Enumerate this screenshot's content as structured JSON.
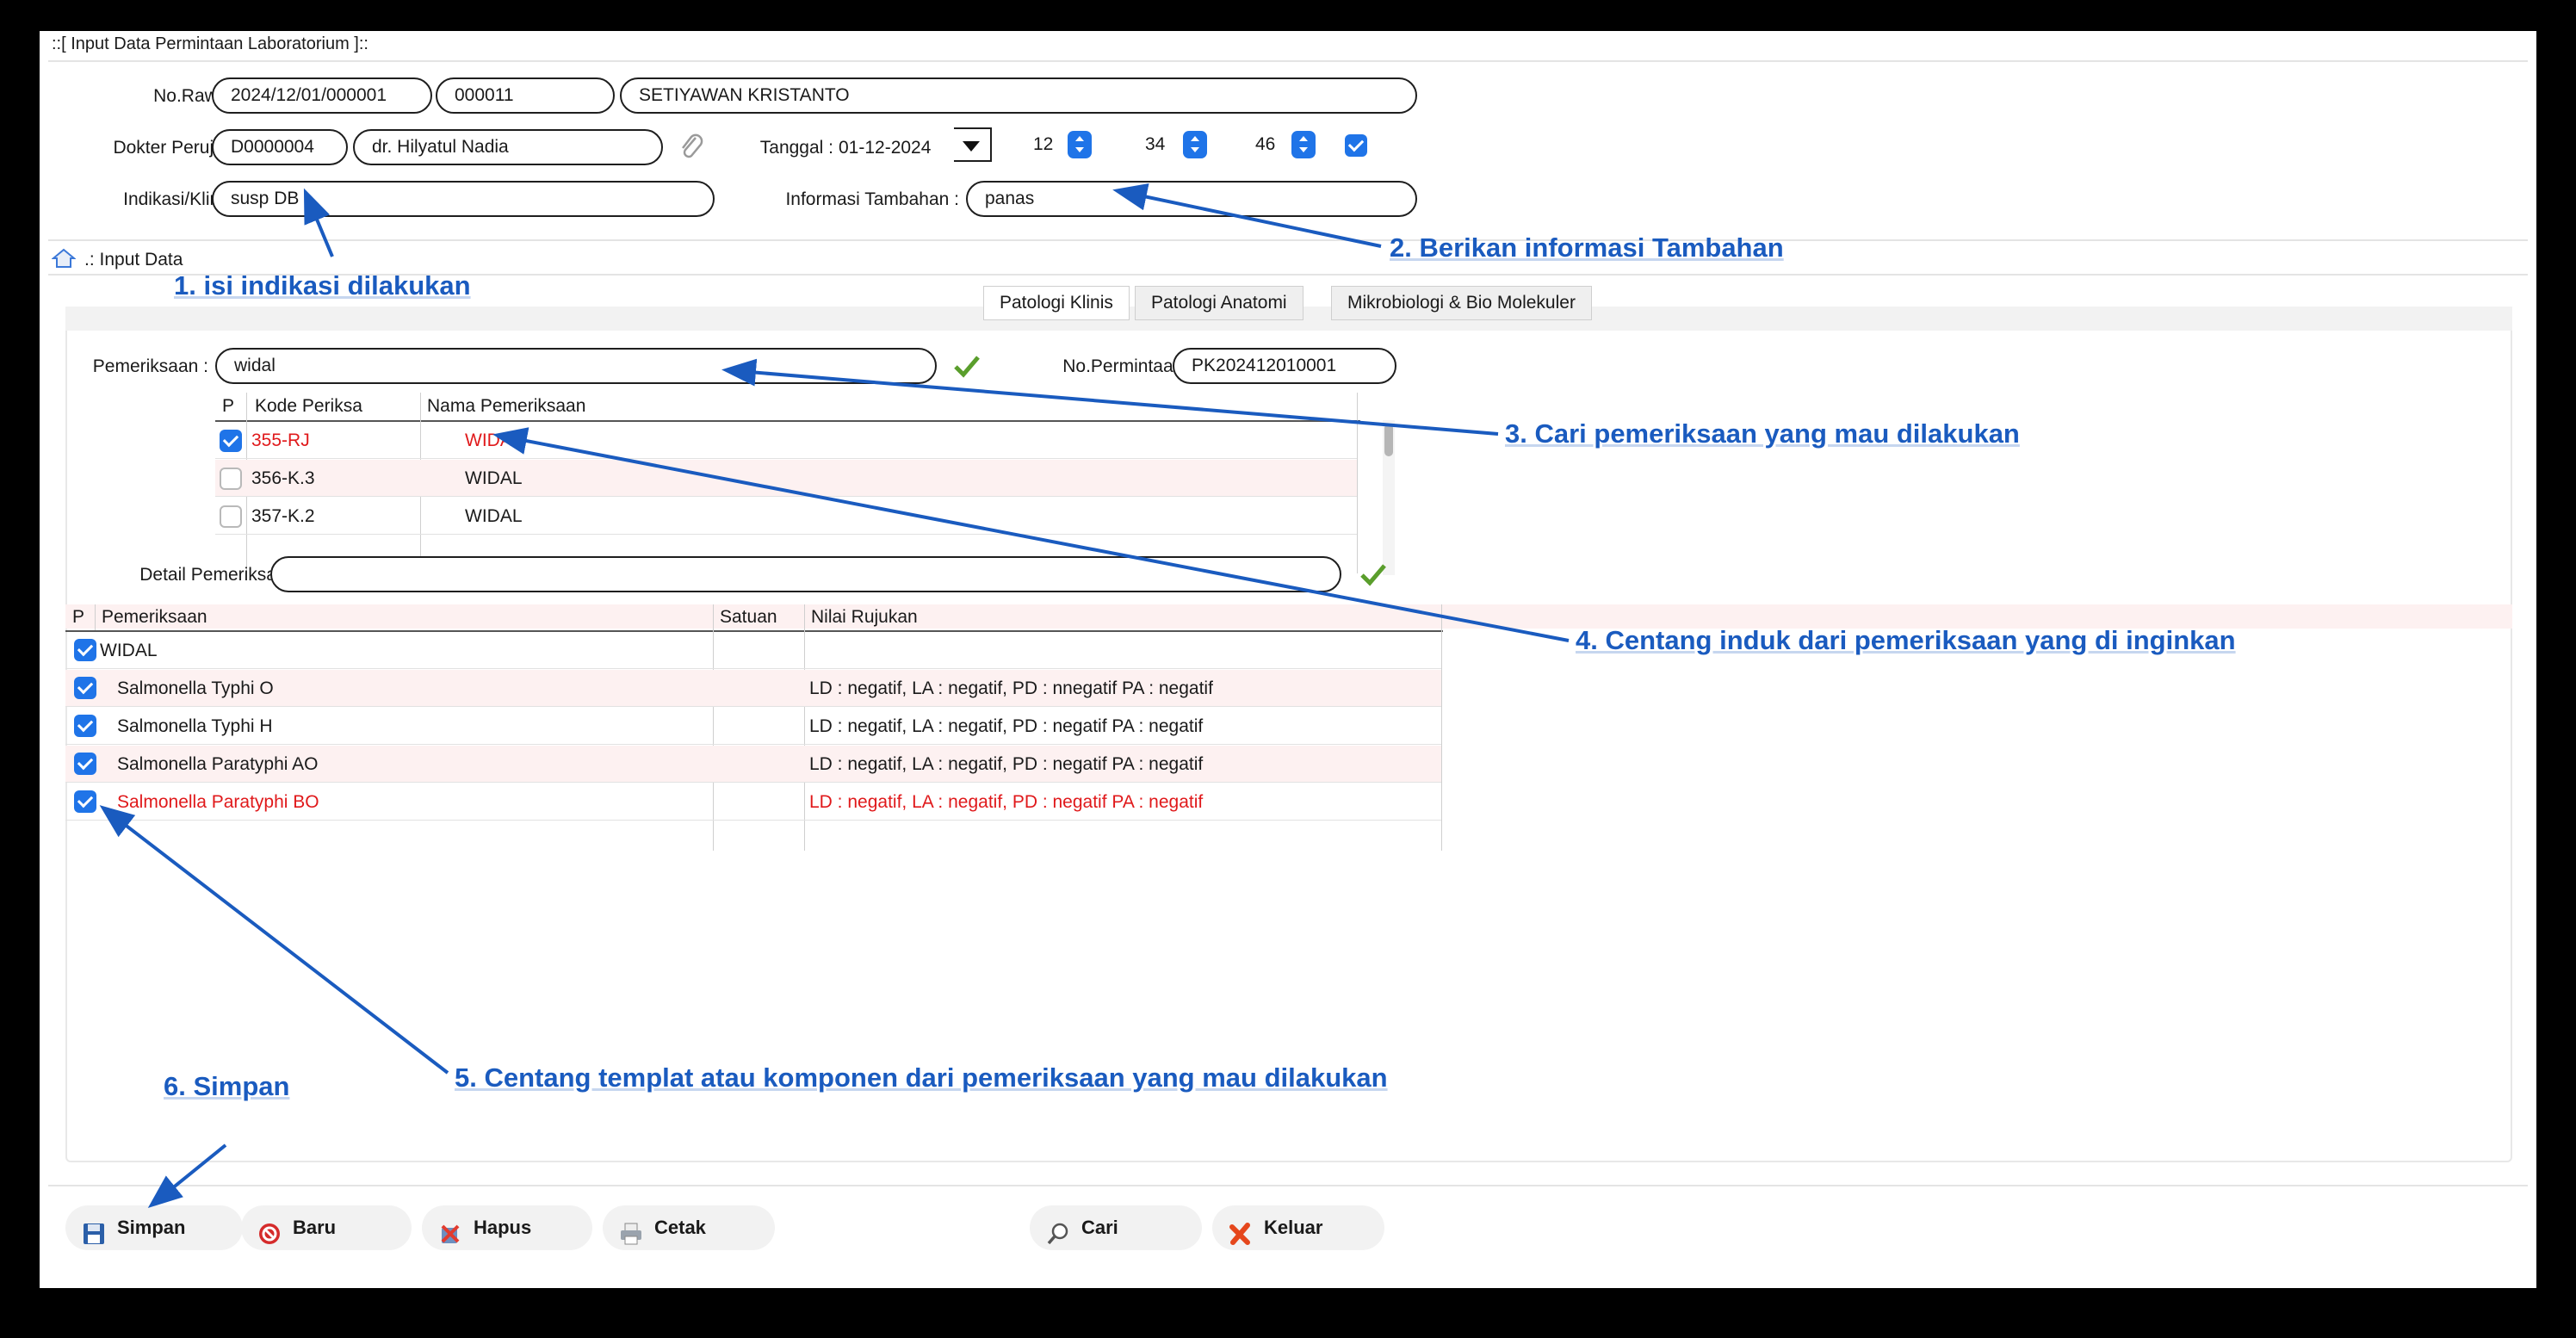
{
  "window_title": "::[ Input Data Permintaan Laboratorium ]::",
  "form": {
    "no_rawat_label": "No.Rawat :",
    "no_rawat": "2024/12/01/000001",
    "no_rm": "000011",
    "patient_name": "SETIYAWAN KRISTANTO",
    "dokter_label": "Dokter Perujuk :",
    "dokter_code": "D0000004",
    "dokter_name": "dr. Hilyatul Nadia",
    "tanggal_label": "Tanggal :",
    "tanggal": "01-12-2024",
    "hour": "12",
    "minute": "34",
    "second": "46",
    "indikasi_label": "Indikasi/Klinis :",
    "indikasi": "susp DB",
    "info_label": "Informasi Tambahan :",
    "info": "panas"
  },
  "section_title": ".: Input Data",
  "tabs": [
    "Patologi Klinis",
    "Patologi Anatomi",
    "Mikrobiologi & Bio Molekuler"
  ],
  "pemeriksaan_label": "Pemeriksaan :",
  "pemeriksaan_value": "widal",
  "no_permintaan_label": "No.Permintaan :",
  "no_permintaan": "PK202412010001",
  "exam_table": {
    "headers": [
      "P",
      "Kode Periksa",
      "Nama Pemeriksaan"
    ],
    "rows": [
      {
        "checked": true,
        "code": "355-RJ",
        "name": "WIDAL",
        "highlight": true
      },
      {
        "checked": false,
        "code": "356-K.3",
        "name": "WIDAL",
        "highlight": false
      },
      {
        "checked": false,
        "code": "357-K.2",
        "name": "WIDAL",
        "highlight": false
      }
    ]
  },
  "detail_label": "Detail Pemeriksaan :",
  "detail_value": "",
  "detail_table": {
    "headers": [
      "P",
      "Pemeriksaan",
      "Satuan",
      "Nilai Rujukan"
    ],
    "rows": [
      {
        "checked": true,
        "name": "WIDAL",
        "satuan": "",
        "rujukan": "",
        "highlight": false
      },
      {
        "checked": true,
        "name": "Salmonella Typhi O",
        "satuan": "",
        "rujukan": "LD : negatif, LA : negatif, PD : nnegatif PA : negatif",
        "highlight": false
      },
      {
        "checked": true,
        "name": "Salmonella Typhi H",
        "satuan": "",
        "rujukan": "LD : negatif, LA : negatif, PD : negatif PA : negatif",
        "highlight": false
      },
      {
        "checked": true,
        "name": "Salmonella Paratyphi AO",
        "satuan": "",
        "rujukan": "LD : negatif, LA : negatif, PD : negatif PA : negatif",
        "highlight": false
      },
      {
        "checked": true,
        "name": "Salmonella Paratyphi BO",
        "satuan": "",
        "rujukan": "LD : negatif, LA : negatif, PD : negatif PA : negatif",
        "highlight": true
      }
    ]
  },
  "buttons": {
    "simpan": "Simpan",
    "baru": "Baru",
    "hapus": "Hapus",
    "cetak": "Cetak",
    "cari": "Cari",
    "keluar": "Keluar"
  },
  "annotations": [
    "1. isi indikasi dilakukan",
    "2. Berikan informasi Tambahan",
    "3. Cari pemeriksaan yang mau dilakukan",
    "4. Centang induk dari pemeriksaan yang di inginkan",
    "5. Centang templat atau komponen dari pemeriksaan yang mau dilakukan",
    "6. Simpan"
  ],
  "colors": {
    "accent": "#1f74e8",
    "highlight_text": "#e0191b",
    "annotation": "#1a5bbf",
    "row_tint": "#fdf1f1"
  }
}
